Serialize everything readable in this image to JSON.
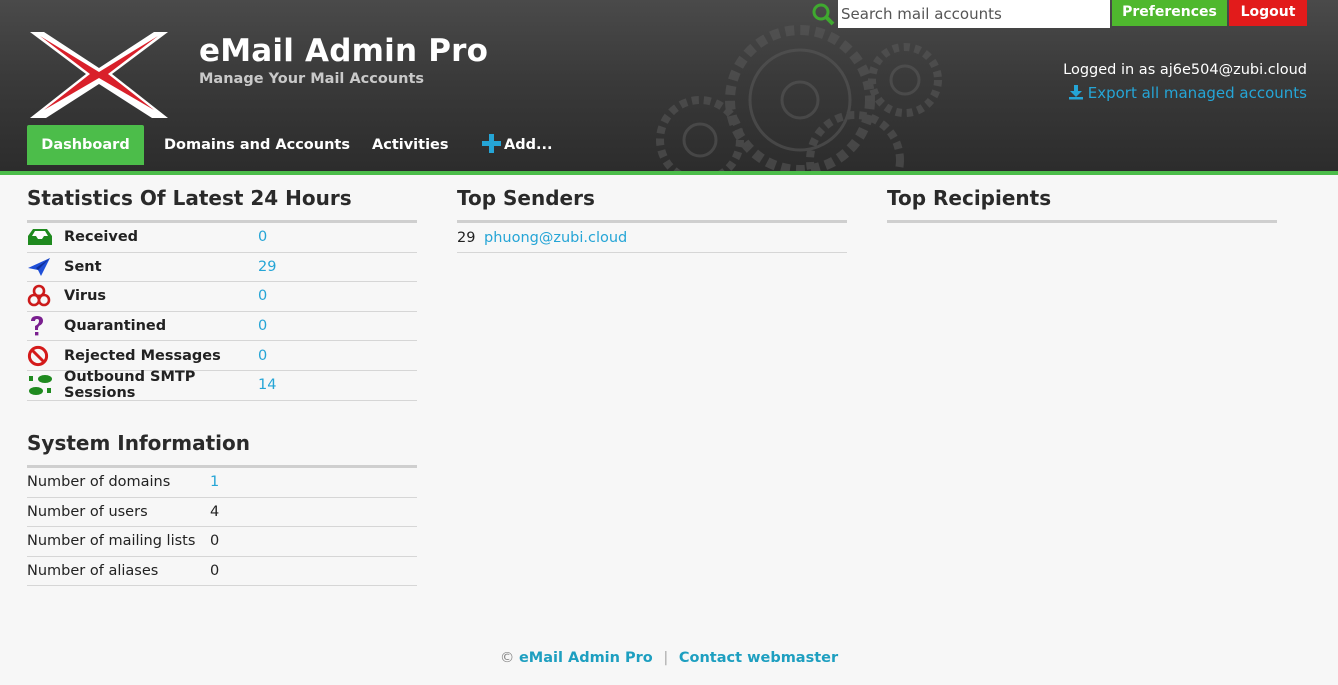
{
  "header": {
    "title": "eMail Admin Pro",
    "subtitle": "Manage Your Mail Accounts",
    "search_placeholder": "Search mail accounts",
    "preferences_label": "Preferences",
    "logout_label": "Logout",
    "logged_in_text": "Logged in as aj6e504@zubi.cloud",
    "export_label": "Export all managed accounts"
  },
  "nav": {
    "dashboard": "Dashboard",
    "domains": "Domains and Accounts",
    "activities": "Activities",
    "add": "Add..."
  },
  "stats": {
    "title": "Statistics Of Latest 24 Hours",
    "rows": [
      {
        "label": "Received",
        "value": "0"
      },
      {
        "label": "Sent",
        "value": "29"
      },
      {
        "label": "Virus",
        "value": "0"
      },
      {
        "label": "Quarantined",
        "value": "0"
      },
      {
        "label": "Rejected Messages",
        "value": "0"
      },
      {
        "label": "Outbound SMTP Sessions",
        "value": "14"
      }
    ]
  },
  "system": {
    "title": "System Information",
    "rows": [
      {
        "label": "Number of domains",
        "value": "1"
      },
      {
        "label": "Number of users",
        "value": "4"
      },
      {
        "label": "Number of mailing lists",
        "value": "0"
      },
      {
        "label": "Number of aliases",
        "value": "0"
      }
    ]
  },
  "top_senders": {
    "title": "Top Senders",
    "rows": [
      {
        "count": "29",
        "address": "phuong@zubi.cloud"
      }
    ]
  },
  "top_recipients": {
    "title": "Top Recipients"
  },
  "footer": {
    "copyright": "©",
    "app_link": "eMail Admin Pro",
    "separator": "|",
    "contact_link": "Contact webmaster"
  },
  "colors": {
    "accent_green": "#4cbd4a",
    "logout_red": "#e21b1b",
    "link_blue": "#25a5d6"
  }
}
